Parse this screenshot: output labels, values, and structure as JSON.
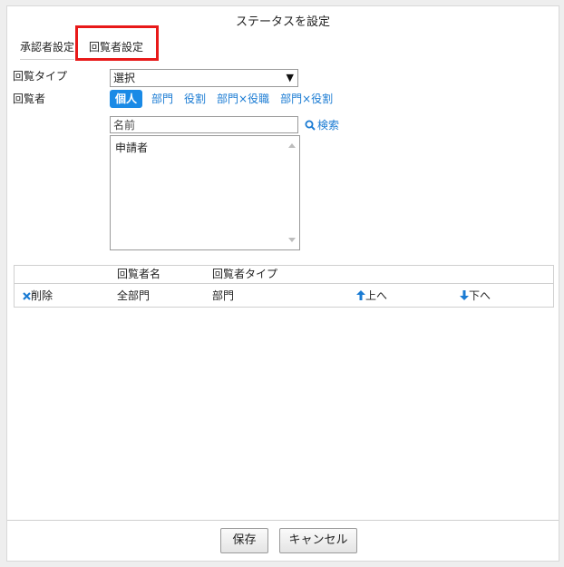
{
  "dialog": {
    "title": "ステータスを設定"
  },
  "tabs": [
    {
      "label": "承認者設定"
    },
    {
      "label": "回覧者設定"
    }
  ],
  "form": {
    "type_label": "回覧タイプ",
    "type_value": "選択",
    "viewer_label": "回覧者",
    "chips": [
      "個人",
      "部門",
      "役割",
      "部門×役職",
      "部門×役割"
    ],
    "name_placeholder": "名前",
    "search_label": "検索",
    "list_items": [
      "申請者"
    ]
  },
  "table": {
    "headers": {
      "name": "回覧者名",
      "type": "回覧者タイプ"
    },
    "rows": [
      {
        "delete": "削除",
        "name": "全部門",
        "type": "部門",
        "up": "上へ",
        "down": "下へ"
      }
    ]
  },
  "footer": {
    "save": "保存",
    "cancel": "キャンセル"
  },
  "colors": {
    "accent": "#1a8ae6",
    "link": "#1a7bd3",
    "highlight": "#e81919"
  }
}
